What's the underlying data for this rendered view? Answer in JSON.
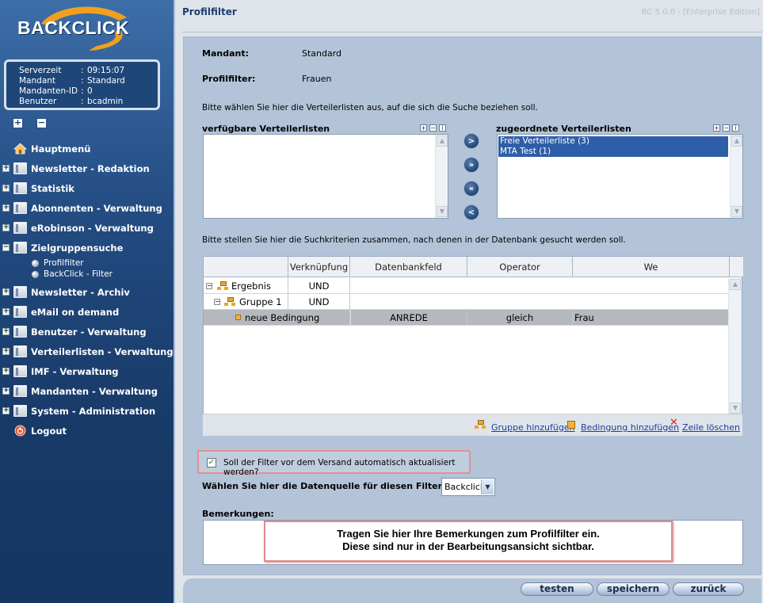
{
  "app": {
    "title": "BACKCLICK",
    "page_title": "Profilfilter",
    "version": "BC 5.0.0 - [Enterprise Edition]"
  },
  "info": [
    {
      "key": "Serverzeit",
      "value": "09:15:07"
    },
    {
      "key": "Mandant",
      "value": "Standard"
    },
    {
      "key": "Mandanten-ID",
      "value": "0"
    },
    {
      "key": "Benutzer",
      "value": "bcadmin"
    }
  ],
  "tree_controls": {
    "expand": "+",
    "collapse": "−"
  },
  "nav": [
    {
      "label": "Hauptmenü",
      "icon": "home-icon"
    },
    {
      "label": "Newsletter - Redaktion",
      "icon": "folder-icon"
    },
    {
      "label": "Statistik",
      "icon": "folder-icon"
    },
    {
      "label": "Abonnenten - Verwaltung",
      "icon": "folder-icon"
    },
    {
      "label": "eRobinson - Verwaltung",
      "icon": "folder-icon"
    },
    {
      "label": "Zielgruppensuche",
      "icon": "folder-open-icon",
      "children": [
        "Profilfilter",
        "BackClick - Filter"
      ]
    },
    {
      "label": "Newsletter - Archiv",
      "icon": "folder-icon"
    },
    {
      "label": "eMail on demand",
      "icon": "folder-icon"
    },
    {
      "label": "Benutzer - Verwaltung",
      "icon": "folder-icon"
    },
    {
      "label": "Verteilerlisten - Verwaltung",
      "icon": "folder-icon"
    },
    {
      "label": "IMF - Verwaltung",
      "icon": "folder-icon"
    },
    {
      "label": "Mandanten - Verwaltung",
      "icon": "folder-icon"
    },
    {
      "label": "System - Administration",
      "icon": "folder-icon"
    },
    {
      "label": "Logout",
      "icon": "logout-icon"
    }
  ],
  "form": {
    "mandant_label": "Mandant:",
    "mandant_value": "Standard",
    "profilfilter_label": "Profilfilter:",
    "profilfilter_value": "Frauen",
    "lists_hint": "Bitte wählen Sie hier die Verteilerlisten aus, auf die sich die Suche beziehen soll.",
    "available_label": "verfügbare Verteilerlisten",
    "assigned_label": "zugeordnete Verteilerlisten",
    "assigned_items": [
      "Freie Verteilerliste (3)",
      "MTA Test (1)"
    ],
    "move_buttons": [
      ">",
      "»",
      "«",
      "<"
    ],
    "criteria_hint": "Bitte stellen Sie hier die Suchkriterien zusammen, nach denen in der Datenbank gesucht werden soll."
  },
  "grid": {
    "columns": [
      "",
      "Verknüpfung",
      "Datenbankfeld",
      "Operator",
      "We"
    ],
    "rows": [
      {
        "name": "Ergebnis",
        "link": "UND",
        "field": "",
        "operator": "",
        "value": ""
      },
      {
        "name": "Gruppe 1",
        "link": "UND",
        "field": "",
        "operator": "",
        "value": ""
      },
      {
        "name": "neue Bedingung",
        "link": "",
        "field": "ANREDE",
        "operator": "gleich",
        "value": "Frau"
      }
    ],
    "actions": [
      "Gruppe hinzufügen",
      "Bedingung hinzufügen",
      "Zeile löschen"
    ]
  },
  "auto_update": {
    "label": "Soll der Filter vor dem Versand automatisch aktualisiert werden?",
    "checked": true
  },
  "datasource": {
    "label": "Wählen Sie hier die Datenquelle für diesen Filter aus:",
    "value": "Backclick"
  },
  "remarks": {
    "label": "Bemerkungen:",
    "callout_line1": "Tragen Sie hier Ihre Bemerkungen zum Profilfilter ein.",
    "callout_line2": "Diese sind nur in der Bearbeitungsansicht sichtbar."
  },
  "buttons": {
    "test": "testen",
    "save": "speichern",
    "back": "zurück"
  },
  "colors": {
    "sidebar": "#234c82",
    "panel": "#b3c4d8",
    "selection": "#2f5ea8",
    "callout_border": "#e18b8b"
  }
}
